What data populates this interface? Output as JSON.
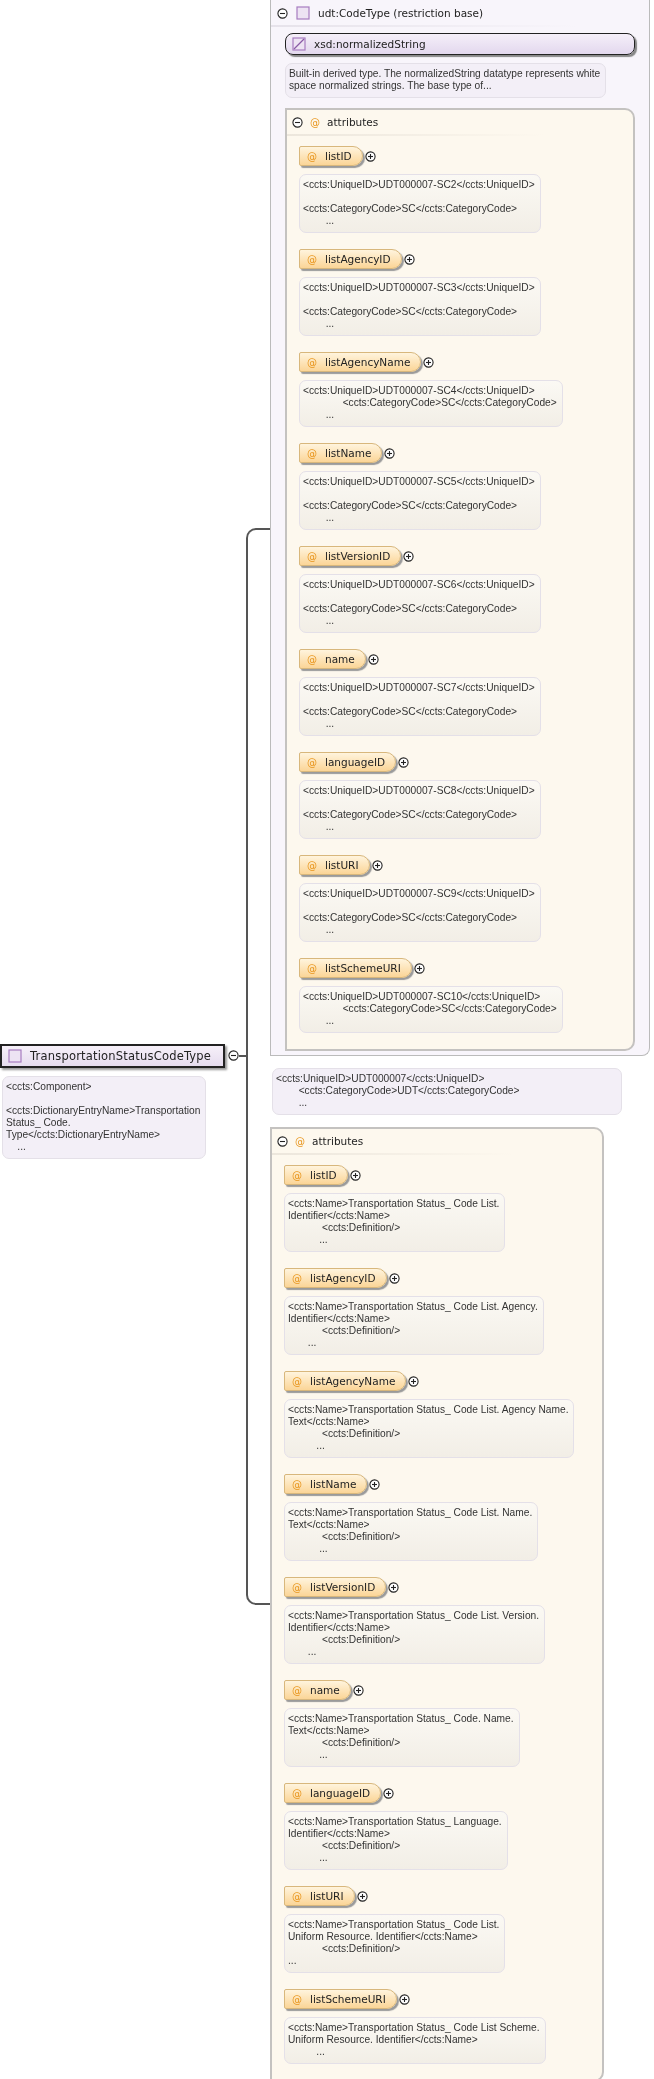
{
  "root": {
    "name": "TransportationStatusCodeType",
    "expanded": true,
    "annotation": "<ccts:Component>\n\n<ccts:DictionaryEntryName>Transportation\nStatus_ Code.\nType</ccts:DictionaryEntryName>\n    ..."
  },
  "base": {
    "title": "udt:CodeType (restriction base)",
    "expanded": true,
    "simple_type": {
      "name": "xsd:normalizedString"
    },
    "description": "Built-in derived type. The normalizedString datatype represents white\nspace normalized strings. The base type of...",
    "attributes": {
      "icon": "@",
      "label": "attributes",
      "expanded": true,
      "items": [
        {
          "icon": "@",
          "name": "listID",
          "expanded": false,
          "annotation": "<ccts:UniqueID>UDT000007-SC2</ccts:UniqueID>\n\n<ccts:CategoryCode>SC</ccts:CategoryCode>\n        ..."
        },
        {
          "icon": "@",
          "name": "listAgencyID",
          "expanded": false,
          "annotation": "<ccts:UniqueID>UDT000007-SC3</ccts:UniqueID>\n\n<ccts:CategoryCode>SC</ccts:CategoryCode>\n        ..."
        },
        {
          "icon": "@",
          "name": "listAgencyName",
          "expanded": false,
          "annotation": "<ccts:UniqueID>UDT000007-SC4</ccts:UniqueID>\n              <ccts:CategoryCode>SC</ccts:CategoryCode>\n        ..."
        },
        {
          "icon": "@",
          "name": "listName",
          "expanded": false,
          "annotation": "<ccts:UniqueID>UDT000007-SC5</ccts:UniqueID>\n\n<ccts:CategoryCode>SC</ccts:CategoryCode>\n        ..."
        },
        {
          "icon": "@",
          "name": "listVersionID",
          "expanded": false,
          "annotation": "<ccts:UniqueID>UDT000007-SC6</ccts:UniqueID>\n\n<ccts:CategoryCode>SC</ccts:CategoryCode>\n        ..."
        },
        {
          "icon": "@",
          "name": "name",
          "expanded": false,
          "annotation": "<ccts:UniqueID>UDT000007-SC7</ccts:UniqueID>\n\n<ccts:CategoryCode>SC</ccts:CategoryCode>\n        ..."
        },
        {
          "icon": "@",
          "name": "languageID",
          "expanded": false,
          "annotation": "<ccts:UniqueID>UDT000007-SC8</ccts:UniqueID>\n\n<ccts:CategoryCode>SC</ccts:CategoryCode>\n        ..."
        },
        {
          "icon": "@",
          "name": "listURI",
          "expanded": false,
          "annotation": "<ccts:UniqueID>UDT000007-SC9</ccts:UniqueID>\n\n<ccts:CategoryCode>SC</ccts:CategoryCode>\n        ..."
        },
        {
          "icon": "@",
          "name": "listSchemeURI",
          "expanded": false,
          "annotation": "<ccts:UniqueID>UDT000007-SC10</ccts:UniqueID>\n              <ccts:CategoryCode>SC</ccts:CategoryCode>\n        ..."
        }
      ]
    }
  },
  "base_annotation": "<ccts:UniqueID>UDT000007</ccts:UniqueID>\n        <ccts:CategoryCode>UDT</ccts:CategoryCode>\n        ...",
  "attributes": {
    "icon": "@",
    "label": "attributes",
    "expanded": true,
    "items": [
      {
        "icon": "@",
        "name": "listID",
        "expanded": false,
        "annotation": "<ccts:Name>Transportation Status_ Code List.\nIdentifier</ccts:Name>\n            <ccts:Definition/>\n           ..."
      },
      {
        "icon": "@",
        "name": "listAgencyID",
        "expanded": false,
        "annotation": "<ccts:Name>Transportation Status_ Code List. Agency.\nIdentifier</ccts:Name>\n            <ccts:Definition/>\n       ..."
      },
      {
        "icon": "@",
        "name": "listAgencyName",
        "expanded": false,
        "annotation": "<ccts:Name>Transportation Status_ Code List. Agency Name.\nText</ccts:Name>\n            <ccts:Definition/>\n          ..."
      },
      {
        "icon": "@",
        "name": "listName",
        "expanded": false,
        "annotation": "<ccts:Name>Transportation Status_ Code List. Name.\nText</ccts:Name>\n            <ccts:Definition/>\n           ..."
      },
      {
        "icon": "@",
        "name": "listVersionID",
        "expanded": false,
        "annotation": "<ccts:Name>Transportation Status_ Code List. Version.\nIdentifier</ccts:Name>\n            <ccts:Definition/>\n       ..."
      },
      {
        "icon": "@",
        "name": "name",
        "expanded": false,
        "annotation": "<ccts:Name>Transportation Status_ Code. Name.\nText</ccts:Name>\n            <ccts:Definition/>\n           ..."
      },
      {
        "icon": "@",
        "name": "languageID",
        "expanded": false,
        "annotation": "<ccts:Name>Transportation Status_ Language.\nIdentifier</ccts:Name>\n            <ccts:Definition/>\n           ..."
      },
      {
        "icon": "@",
        "name": "listURI",
        "expanded": false,
        "annotation": "<ccts:Name>Transportation Status_ Code List.\nUniform Resource. Identifier</ccts:Name>\n            <ccts:Definition/>\n..."
      },
      {
        "icon": "@",
        "name": "listSchemeURI",
        "expanded": false,
        "annotation": "<ccts:Name>Transportation Status_ Code List Scheme.\nUniform Resource. Identifier</ccts:Name>\n          ..."
      }
    ]
  }
}
